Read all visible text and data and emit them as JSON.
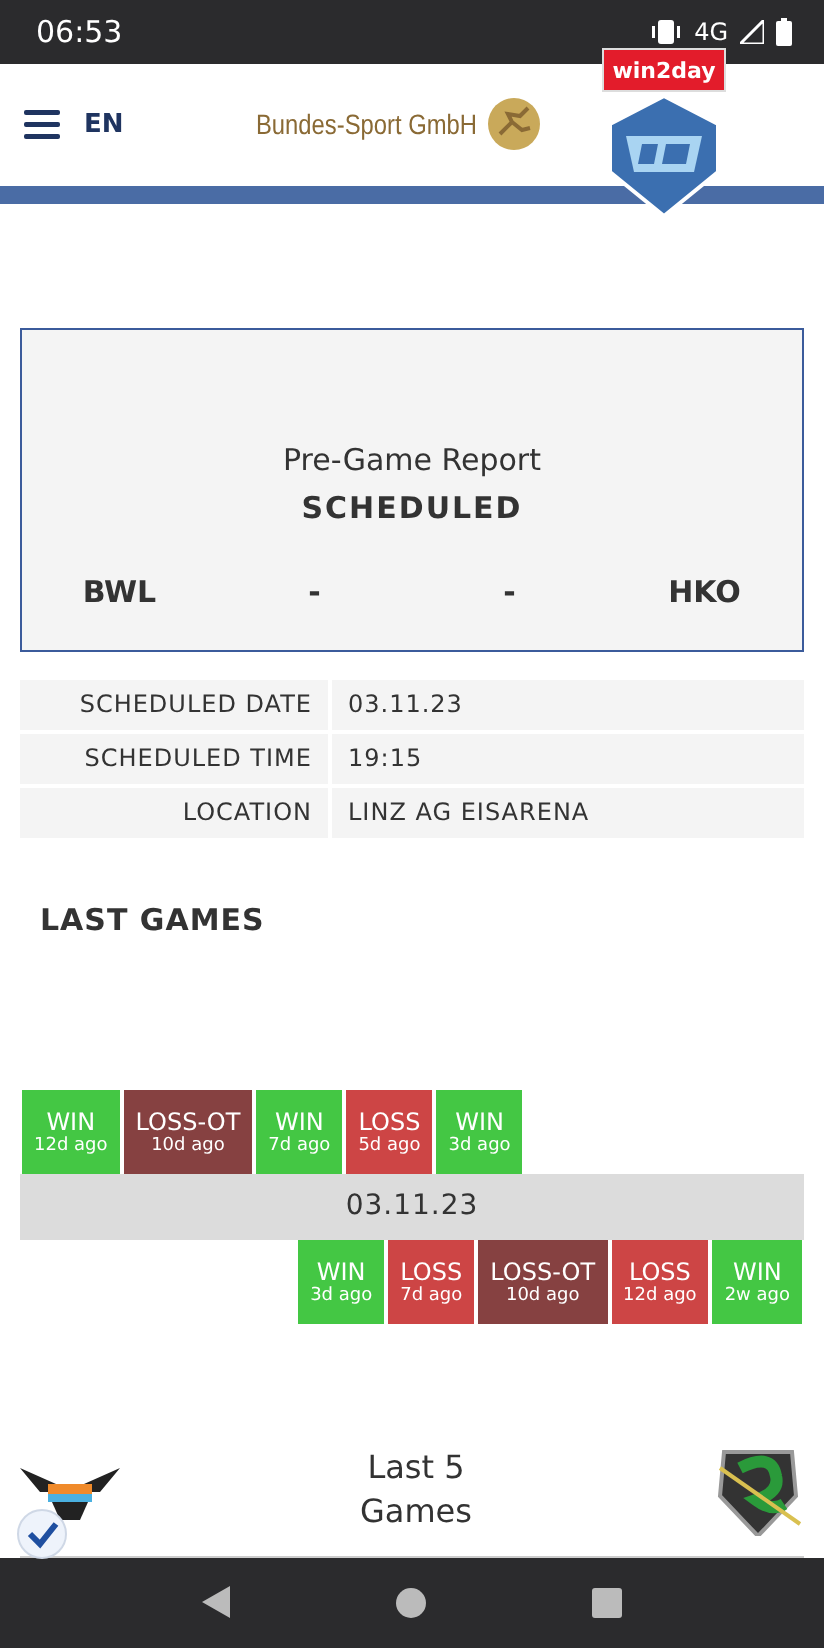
{
  "status_bar": {
    "time": "06:53",
    "network": "4G"
  },
  "header": {
    "language": "EN",
    "sponsor": "Bundes-Sport GmbH",
    "league_badge": "win2day"
  },
  "report": {
    "title": "Pre-Game Report",
    "status": "SCHEDULED",
    "home": "BWL",
    "home_score": "-",
    "away_score": "-",
    "away": "HKO"
  },
  "info": [
    {
      "label": "SCHEDULED DATE",
      "value": "03.11.23"
    },
    {
      "label": "SCHEDULED TIME",
      "value": "19:15"
    },
    {
      "label": "LOCATION",
      "value": "LINZ AG EISARENA"
    }
  ],
  "last_games": {
    "title": "LAST GAMES",
    "date": "03.11.23",
    "home": [
      {
        "kind": "win",
        "result": "WIN",
        "ago": "12d ago"
      },
      {
        "kind": "loss-ot",
        "result": "LOSS-OT",
        "ago": "10d ago"
      },
      {
        "kind": "win",
        "result": "WIN",
        "ago": "7d ago"
      },
      {
        "kind": "loss",
        "result": "LOSS",
        "ago": "5d ago"
      },
      {
        "kind": "win",
        "result": "WIN",
        "ago": "3d ago"
      }
    ],
    "away": [
      {
        "kind": "win",
        "result": "WIN",
        "ago": "3d ago"
      },
      {
        "kind": "loss",
        "result": "LOSS",
        "ago": "7d ago"
      },
      {
        "kind": "loss-ot",
        "result": "LOSS-OT",
        "ago": "10d ago"
      },
      {
        "kind": "loss",
        "result": "LOSS",
        "ago": "12d ago"
      },
      {
        "kind": "win",
        "result": "WIN",
        "ago": "2w ago"
      }
    ]
  },
  "last5": {
    "title": "Last 5 Games"
  }
}
